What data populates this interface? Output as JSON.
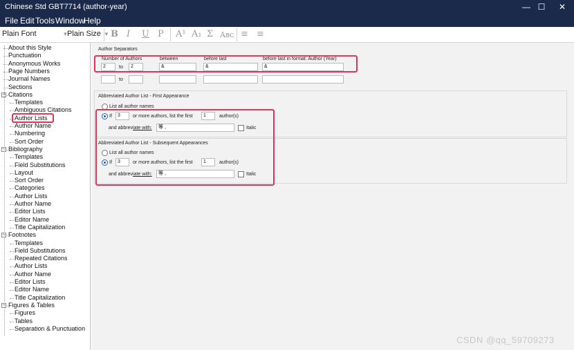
{
  "window": {
    "title": "Chinese Std GBT7714 (author-year)",
    "controls": [
      "—",
      "☐",
      "✕"
    ]
  },
  "menu": [
    "File",
    "Edit",
    "Tools",
    "Window",
    "Help"
  ],
  "toolbar": {
    "font": "Plain Font",
    "size": "Plain Size",
    "buttons": [
      "B",
      "I",
      "U",
      "P",
      "A¹",
      "A₁",
      "Σ",
      "Aʙᴄ",
      "≡",
      "≡"
    ]
  },
  "sidebar": {
    "items": [
      {
        "label": "About this Style",
        "level": 0
      },
      {
        "label": "Punctuation",
        "level": 0
      },
      {
        "label": "Anonymous Works",
        "level": 0
      },
      {
        "label": "Page Numbers",
        "level": 0
      },
      {
        "label": "Journal Names",
        "level": 0
      },
      {
        "label": "Sections",
        "level": 0
      },
      {
        "label": "Citations",
        "level": 0,
        "toggle": "−"
      },
      {
        "label": "Templates",
        "level": 1
      },
      {
        "label": "Ambiguous Citations",
        "level": 1
      },
      {
        "label": "Author Lists",
        "level": 1,
        "selected": true
      },
      {
        "label": "Author Name",
        "level": 1
      },
      {
        "label": "Numbering",
        "level": 1
      },
      {
        "label": "Sort Order",
        "level": 1
      },
      {
        "label": "Bibliography",
        "level": 0,
        "toggle": "−"
      },
      {
        "label": "Templates",
        "level": 1
      },
      {
        "label": "Field Substitutions",
        "level": 1
      },
      {
        "label": "Layout",
        "level": 1
      },
      {
        "label": "Sort Order",
        "level": 1
      },
      {
        "label": "Categories",
        "level": 1
      },
      {
        "label": "Author Lists",
        "level": 1
      },
      {
        "label": "Author Name",
        "level": 1
      },
      {
        "label": "Editor Lists",
        "level": 1
      },
      {
        "label": "Editor Name",
        "level": 1
      },
      {
        "label": "Title Capitalization",
        "level": 1
      },
      {
        "label": "Footnotes",
        "level": 0,
        "toggle": "−"
      },
      {
        "label": "Templates",
        "level": 1
      },
      {
        "label": "Field Substitutions",
        "level": 1
      },
      {
        "label": "Repeated Citations",
        "level": 1
      },
      {
        "label": "Author Lists",
        "level": 1
      },
      {
        "label": "Author Name",
        "level": 1
      },
      {
        "label": "Editor Lists",
        "level": 1
      },
      {
        "label": "Editor Name",
        "level": 1
      },
      {
        "label": "Title Capitalization",
        "level": 1
      },
      {
        "label": "Figures & Tables",
        "level": 0,
        "toggle": "−"
      },
      {
        "label": "Figures",
        "level": 1
      },
      {
        "label": "Tables",
        "level": 1
      },
      {
        "label": "Separation & Punctuation",
        "level": 1
      }
    ]
  },
  "separators": {
    "heading": "Author Separators",
    "col_number": "Number of Authors",
    "col_between": "between",
    "col_before_last": "before last",
    "col_before_last_fmt": "before last in format: Author (Year)",
    "row1": {
      "from": "2",
      "to_label": "to",
      "to": "2",
      "between": "&",
      "before_last": "&",
      "before_last_fmt": "&"
    },
    "row2": {
      "from": "",
      "to_label": "to",
      "to": "",
      "between": "",
      "before_last": "",
      "before_last_fmt": ""
    }
  },
  "first_appearance": {
    "heading": "Abbreviated Author List - First Appearance",
    "list_all": "List all author names",
    "if_label": "If",
    "if_value": "3",
    "more_label": "or more authors, list the first",
    "first_value": "1",
    "authors_label": "author(s)",
    "abbrev_label": "and abbrev",
    "abbrev_label_u": "iate with:",
    "abbrev_value": "等 ,",
    "italic": "Italic"
  },
  "subsequent": {
    "heading": "Abbreviated Author List - Subsequent Appearances",
    "list_all": "List all author names",
    "if_label": "If",
    "if_value": "3",
    "more_label": "or more authors, list the first",
    "first_value": "1",
    "authors_label": "author(s)",
    "abbrev_label": "and abbrev",
    "abbrev_label_u": "iate with:",
    "abbrev_value": "等 ,",
    "italic": "Italic"
  },
  "watermark": "CSDN @qq_59709273"
}
